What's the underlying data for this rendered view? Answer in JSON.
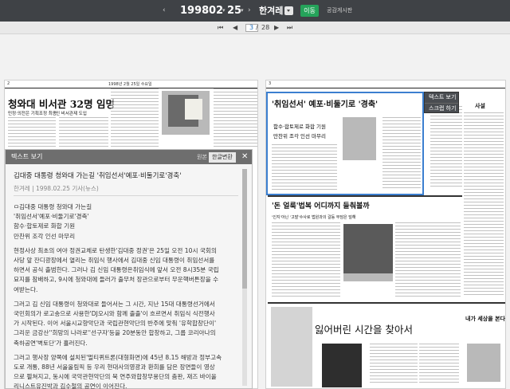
{
  "date_nav": {
    "prev_arrow": "‹",
    "year": "1998",
    "month": "02",
    "day": "25",
    "next_arrow": "›",
    "newspaper": "한겨레",
    "go_button": "이동",
    "notice_link": "공감게시판"
  },
  "pager": {
    "first": "⏮",
    "prev": "◀",
    "current": "3",
    "separator": "/",
    "total": "28",
    "next": "▶",
    "last": "⏭"
  },
  "newspaper_left": {
    "header_page": "2",
    "header_date": "1998년 2월 25일 수요일",
    "headline": "청와대 비서관 32명 임명",
    "subhead_1": "민정·의전은 기획조정 최종",
    "subhead_2": "인 비서관제 도입"
  },
  "newspaper_right": {
    "header_page": "3",
    "headline_selected": "'취임선서' 예포·비둘기로 '경축'",
    "selected_subhead_1": "함수·합토제로 화합 기원",
    "selected_subhead_2": "만찬위 조각 인선 마무리",
    "headline_mid": "'돈 얼룩'법복 어디까지 들춰볼까",
    "mid_subhead": "'인지'아닌 '고발'수사로 법원과의 갈등 부담은 덜해",
    "ad_headline": "잃어버린 시간을 찾아서",
    "ad_side_headline": "내가 세상을 본다",
    "column_title": "사설"
  },
  "article_panel": {
    "title": "텍스트 보기",
    "tab_original": "원본",
    "tab_translation": "한글변환",
    "close": "✕",
    "headline": "김대중 대통령 청와대 가는길 '취임선서'예포·비둘기로'경축'",
    "meta": "한겨레 | 1998.02.25 기사(뉴스)",
    "body_lines": [
      "ㅁ김대중 대통령 청와대 가는길",
      "'취임선서'예포·비둘기로'경축'",
      "함수·합토제로 화합 기원",
      "만찬위 조각 인선 마무리",
      "",
      "현정사상 최초의 여야 정권교체로 탄생한'김대중 정권'은 25일 오전 10시 국회의",
      "사당 앞 잔디광장에서 열리는 취임식 행사에서 김대중 신임 대통령이 취임선서를",
      "하면서 공식 출범한다. 그러나 김 신임 대통령은취임식에 앞서 오전 8시35분 국립",
      "묘지를 참배하고, 9시에 청와대에 들러가 출무처 장관으로부터 무운핵버튼장을 수",
      "여받는다.",
      "",
      "그러고 김 신임 대통령이 청와대로 들어서는 그 시간, 지난 15대 대통령선거에서",
      "국민회의가 로고송으로 사용한'DJ오시와 함께 출출'이 흐르면서 취임식 식전행사",
      "가 시작된다. 이어 서울시교향악단과 국립관현악단의 반주에 맞춰 '유학합창단이'",
      "그리운 금강산''희망의 나라로''선구자'등을 20분동안 합창하고, 그룹 코리아나의",
      "축하공연'벽토단'가 흘러진다.",
      "",
      "그러고 행사장 양쪽에 설치된'멀티퀴트론(대형화면)에 45년 8.15 해방과 정부고속",
      "도로 개통, 88년 서울올림픽 등 우리 현대사의영광과 환희를 담은 장면들이 영상",
      "으로 펼쳐지고, 동시에 국악관현악단의 북 연주와합창무용단의 춤판, 재즈 바이올",
      "리니스트유진박과 김수철의 공연이 이어진다."
    ]
  },
  "context_menu": {
    "items": [
      "텍스트 보기",
      "스크랩 하기"
    ]
  }
}
